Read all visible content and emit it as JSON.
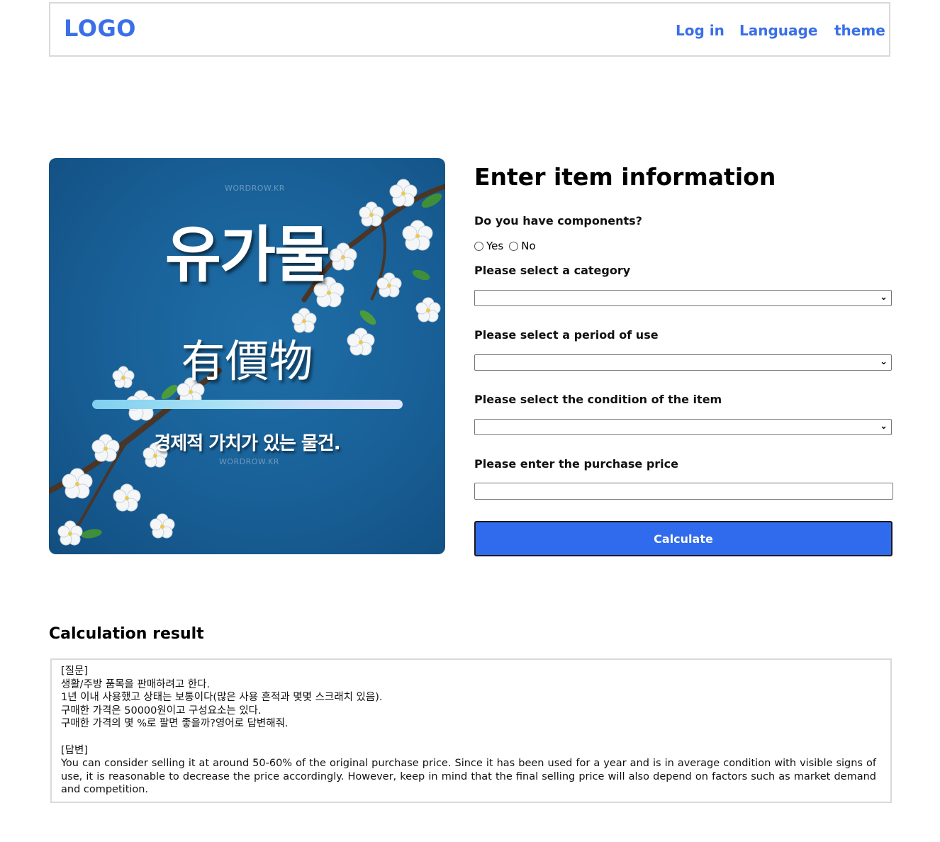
{
  "header": {
    "logo": "LOGO",
    "nav": {
      "login": "Log in",
      "language": "Language",
      "theme": "theme"
    }
  },
  "hero": {
    "watermark": "WORDROW.KR",
    "title_ko": "유가물",
    "title_hanja": "有價物",
    "subtitle": "경제적 가치가 있는 물건.",
    "background_color": "#185f96"
  },
  "form": {
    "title": "Enter item information",
    "components_label": "Do you have components?",
    "options": {
      "yes": "Yes",
      "no": "No"
    },
    "category_label": "Please select a category",
    "period_label": "Please select a period of use",
    "condition_label": "Please select the condition of the item",
    "price_label": "Please enter the purchase price",
    "calculate_label": "Calculate",
    "accent_color": "#2f6bec"
  },
  "result": {
    "title": "Calculation result",
    "question_header": "[질문]",
    "question_lines": [
      "생활/주방 품목을 판매하려고 한다.",
      "1년 이내 사용했고 상태는 보통이다(많은 사용 흔적과 몇몇 스크래치 있음).",
      "구매한 가격은 50000원이고 구성요소는 있다.",
      "구매한 가격의 몇 %로 팔면 좋을까?영어로 답변해줘."
    ],
    "answer_header": "[답변]",
    "answer": "You can consider selling it at around 50-60% of the original purchase price. Since it has been used for a year and is in average condition with visible signs of use, it is reasonable to decrease the price accordingly. However, keep in mind that the final selling price will also depend on factors such as market demand and competition."
  }
}
